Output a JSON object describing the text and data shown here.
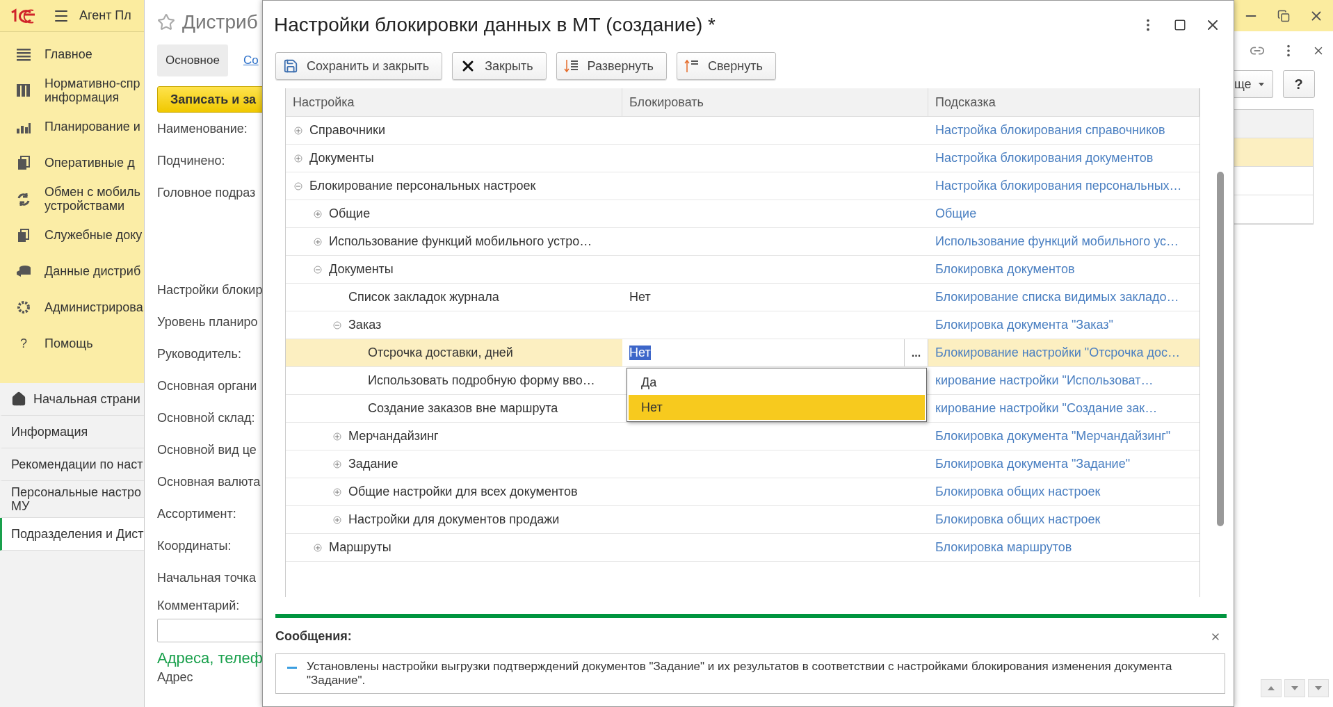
{
  "app_bar": {
    "title": "Агент Пл"
  },
  "sections": [
    {
      "label": "Главное"
    },
    {
      "label": "Нормативно-спр\nинформация"
    },
    {
      "label": "Планирование и"
    },
    {
      "label": "Оперативные д"
    },
    {
      "label": "Обмен с мобиль\nустройствами"
    },
    {
      "label": "Служебные доку"
    },
    {
      "label": "Данные дистриб"
    },
    {
      "label": "Администрирова"
    },
    {
      "label": "Помощь",
      "glyph": "?"
    }
  ],
  "open_windows": [
    {
      "label": "Начальная страни",
      "selected": false
    },
    {
      "label": "Информация",
      "selected": false
    },
    {
      "label": "Рекомендации по наст",
      "selected": false
    },
    {
      "label": "Персональные настро\nМУ",
      "selected": false
    },
    {
      "label": "Подразделения и Дист",
      "selected": true
    }
  ],
  "form": {
    "title": "Дистриб",
    "tabs": [
      {
        "label": "Основное",
        "selected": true
      },
      {
        "label": "Со",
        "selected": false
      }
    ],
    "save_button": "Записать и за",
    "fields_top": [
      "Наименование:",
      "Подчинено:",
      "Головное подраз"
    ],
    "fields": [
      "Настройки блокир",
      "Уровень планиро",
      "Руководитель:",
      "Основная органи",
      "Основной склад:",
      "Основной вид це",
      "Основная валюта",
      "Ассортимент:",
      "Координаты:",
      "Начальная точка"
    ],
    "comment_label": "Комментарий:",
    "section_title": "Адреса, телеф",
    "address_label": "Адрес"
  },
  "dialog": {
    "title": "Настройки блокировки данных в МТ (создание) *",
    "toolbar": [
      {
        "label": "Сохранить и закрыть"
      },
      {
        "label": "Закрыть"
      },
      {
        "label": "Развернуть"
      },
      {
        "label": "Свернуть"
      }
    ],
    "table": {
      "columns": [
        "Настройка",
        "Блокировать",
        "Подсказка"
      ],
      "rows": [
        {
          "name": "Справочники",
          "hint": "Настройка блокирования справочников",
          "expanded": false,
          "selected": false
        },
        {
          "name": "Документы",
          "hint": "Настройка блокирования документов",
          "expanded": false,
          "selected": false
        },
        {
          "name": "Блокирование персональных настроек",
          "hint": "Настройка блокирования персональных…",
          "expanded": true,
          "selected": false,
          "children": [
            {
              "name": "Общие",
              "hint": "Общие",
              "expanded": false,
              "selected": false
            },
            {
              "name": "Использование функций мобильного устро…",
              "hint": "Использование функций мобильного ус…",
              "expanded": false,
              "selected": false
            },
            {
              "name": "Документы",
              "hint": "Блокировка документов",
              "expanded": true,
              "selected": false,
              "children": [
                {
                  "name": "Список закладок журнала",
                  "value": "Нет",
                  "hint": "Блокирование списка видимых закладо…",
                  "selected": false
                },
                {
                  "name": "Заказ",
                  "hint": "Блокировка документа \"Заказ\"",
                  "expanded": true,
                  "selected": false,
                  "children": [
                    {
                      "name": "Отсрочка доставки, дней",
                      "value": "Нет",
                      "hint": "Блокирование настройки \"Отсрочка дос…",
                      "selected": true
                    },
                    {
                      "name": "Использовать подробную форму вво…",
                      "hint": "кирование настройки \"Использоват…",
                      "selected": false
                    },
                    {
                      "name": "Создание заказов вне маршрута",
                      "hint": "кирование настройки \"Создание зак…",
                      "selected": false
                    }
                  ]
                },
                {
                  "name": "Мерчандайзинг",
                  "hint": "Блокировка документа \"Мерчандайзинг\"",
                  "expanded": false,
                  "selected": false
                },
                {
                  "name": "Задание",
                  "hint": "Блокировка документа \"Задание\"",
                  "expanded": false,
                  "selected": false
                },
                {
                  "name": "Общие настройки для всех документов",
                  "hint": "Блокировка общих настроек",
                  "expanded": false,
                  "selected": false
                },
                {
                  "name": "Настройки для документов продажи",
                  "hint": "Блокировка общих настроек",
                  "expanded": false,
                  "selected": false
                }
              ]
            },
            {
              "name": "Маршруты",
              "hint": "Блокировка маршрутов",
              "expanded": false,
              "selected": false
            }
          ]
        }
      ],
      "choose_button": "...",
      "dropdown": [
        {
          "label": "Да",
          "selected": false
        },
        {
          "label": "Нет",
          "selected": true
        }
      ]
    },
    "messages": {
      "title": "Сообщения:",
      "items": [
        "Установлены настройки выгрузки подтверждений документов \"Задание\" и их результатов в соответствии с настройками блокирования изменения документа \"Задание\"."
      ]
    }
  },
  "right_panel": {
    "more_button": "ще",
    "help_button": "?",
    "rows": [
      {
        "selected": true
      },
      {
        "selected": false
      },
      {
        "selected": false
      }
    ]
  }
}
